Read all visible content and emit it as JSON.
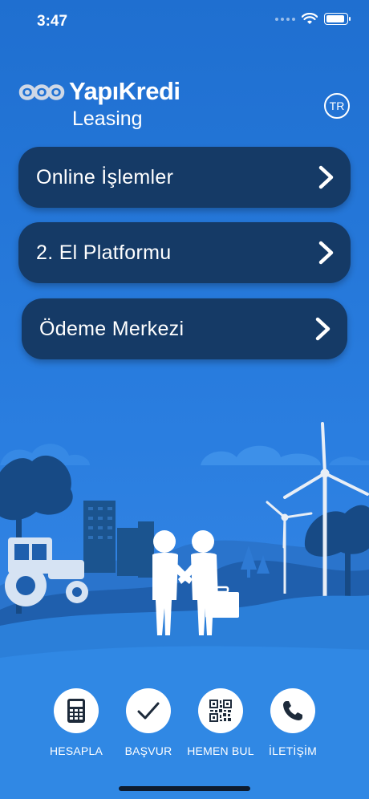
{
  "status": {
    "time": "3:47"
  },
  "brand": {
    "name": "YapıKredi",
    "sub": "Leasing"
  },
  "language": {
    "label": "TR"
  },
  "menu": [
    {
      "label": "Online İşlemler"
    },
    {
      "label": "2. El Platformu"
    },
    {
      "label": "Ödeme Merkezi"
    }
  ],
  "nav": [
    {
      "label": "HESAPLA",
      "icon": "calculator-icon"
    },
    {
      "label": "BAŞVUR",
      "icon": "checkmark-icon"
    },
    {
      "label": "HEMEN BUL",
      "icon": "qr-code-icon"
    },
    {
      "label": "İLETİŞİM",
      "icon": "phone-icon"
    }
  ],
  "colors": {
    "background": "#2a7ee0",
    "button": "#153a66",
    "scene_dark": "#1a4f8f"
  }
}
